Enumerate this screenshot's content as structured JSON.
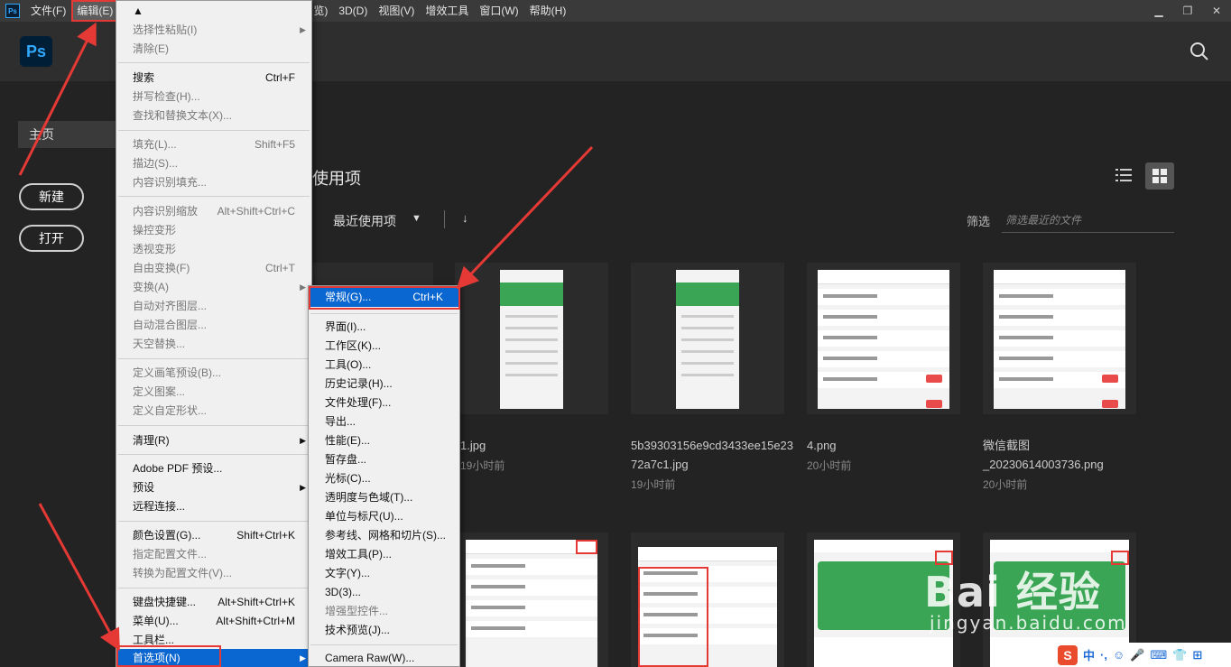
{
  "menubar": {
    "app_icon": "Ps",
    "items": [
      "文件(F)",
      "编辑(E)",
      "视图(V)",
      "增效工具",
      "窗口(W)",
      "帮助(H)"
    ],
    "partial_items": [
      "览)",
      "3D(D)"
    ],
    "window_controls": [
      "minimize-icon",
      "restore-icon",
      "close-icon"
    ]
  },
  "header": {
    "logo": "Ps",
    "search_icon": "search-icon"
  },
  "sidebar": {
    "home": "主页",
    "new_button": "新建",
    "open_button": "打开"
  },
  "main": {
    "section_title": "使用项",
    "sort_label": "最近使用项",
    "sort_dir_icon": "↓",
    "filter_label": "筛选",
    "filter_placeholder": "筛选最近的文件",
    "view_icons": [
      "list-view-icon",
      "grid-view-icon"
    ],
    "files": [
      {
        "name": "1.jpg",
        "time": "19小时前"
      },
      {
        "name": "5b39303156e9cd3433ee15e23 72a7c1.jpg",
        "time": "19小时前"
      },
      {
        "name": "4.png",
        "time": "20小时前"
      },
      {
        "name": "微信截图 _20230614003736.png",
        "time": "20小时前"
      }
    ]
  },
  "edit_menu": {
    "items": [
      {
        "label": "选择性粘贴(I)",
        "shortcut": "",
        "disabled": true
      },
      {
        "label": "清除(E)",
        "shortcut": "",
        "disabled": true
      },
      {
        "label": "搜索",
        "shortcut": "Ctrl+F",
        "disabled": false
      },
      {
        "label": "拼写检查(H)...",
        "shortcut": "",
        "disabled": true
      },
      {
        "label": "查找和替换文本(X)...",
        "shortcut": "",
        "disabled": true
      },
      {
        "label": "填充(L)...",
        "shortcut": "Shift+F5",
        "disabled": true
      },
      {
        "label": "描边(S)...",
        "shortcut": "",
        "disabled": true
      },
      {
        "label": "内容识别填充...",
        "shortcut": "",
        "disabled": true
      },
      {
        "label": "内容识别缩放",
        "shortcut": "Alt+Shift+Ctrl+C",
        "disabled": true
      },
      {
        "label": "操控变形",
        "shortcut": "",
        "disabled": true
      },
      {
        "label": "透视变形",
        "shortcut": "",
        "disabled": true
      },
      {
        "label": "自由变换(F)",
        "shortcut": "Ctrl+T",
        "disabled": true
      },
      {
        "label": "变换(A)",
        "shortcut": "",
        "disabled": true
      },
      {
        "label": "自动对齐图层...",
        "shortcut": "",
        "disabled": true
      },
      {
        "label": "自动混合图层...",
        "shortcut": "",
        "disabled": true
      },
      {
        "label": "天空替换...",
        "shortcut": "",
        "disabled": true
      },
      {
        "label": "定义画笔预设(B)...",
        "shortcut": "",
        "disabled": true
      },
      {
        "label": "定义图案...",
        "shortcut": "",
        "disabled": true
      },
      {
        "label": "定义自定形状...",
        "shortcut": "",
        "disabled": true
      },
      {
        "label": "清理(R)",
        "shortcut": "",
        "disabled": false
      },
      {
        "label": "Adobe PDF 预设...",
        "shortcut": "",
        "disabled": false
      },
      {
        "label": "预设",
        "shortcut": "",
        "disabled": false
      },
      {
        "label": "远程连接...",
        "shortcut": "",
        "disabled": false
      },
      {
        "label": "颜色设置(G)...",
        "shortcut": "Shift+Ctrl+K",
        "disabled": false
      },
      {
        "label": "指定配置文件...",
        "shortcut": "",
        "disabled": true
      },
      {
        "label": "转换为配置文件(V)...",
        "shortcut": "",
        "disabled": true
      },
      {
        "label": "键盘快捷键...",
        "shortcut": "Alt+Shift+Ctrl+K",
        "disabled": false
      },
      {
        "label": "菜单(U)...",
        "shortcut": "Alt+Shift+Ctrl+M",
        "disabled": false
      },
      {
        "label": "工具栏...",
        "shortcut": "",
        "disabled": false
      },
      {
        "label": "首选项(N)",
        "shortcut": "",
        "disabled": false
      }
    ]
  },
  "prefs_menu": {
    "items": [
      {
        "label": "常规(G)...",
        "shortcut": "Ctrl+K",
        "disabled": false
      },
      {
        "label": "界面(I)...",
        "shortcut": "",
        "disabled": false
      },
      {
        "label": "工作区(K)...",
        "shortcut": "",
        "disabled": false
      },
      {
        "label": "工具(O)...",
        "shortcut": "",
        "disabled": false
      },
      {
        "label": "历史记录(H)...",
        "shortcut": "",
        "disabled": false
      },
      {
        "label": "文件处理(F)...",
        "shortcut": "",
        "disabled": false
      },
      {
        "label": "导出...",
        "shortcut": "",
        "disabled": false
      },
      {
        "label": "性能(E)...",
        "shortcut": "",
        "disabled": false
      },
      {
        "label": "暂存盘...",
        "shortcut": "",
        "disabled": false
      },
      {
        "label": "光标(C)...",
        "shortcut": "",
        "disabled": false
      },
      {
        "label": "透明度与色域(T)...",
        "shortcut": "",
        "disabled": false
      },
      {
        "label": "单位与标尺(U)...",
        "shortcut": "",
        "disabled": false
      },
      {
        "label": "参考线、网格和切片(S)...",
        "shortcut": "",
        "disabled": false
      },
      {
        "label": "增效工具(P)...",
        "shortcut": "",
        "disabled": false
      },
      {
        "label": "文字(Y)...",
        "shortcut": "",
        "disabled": false
      },
      {
        "label": "3D(3)...",
        "shortcut": "",
        "disabled": false
      },
      {
        "label": "增强型控件...",
        "shortcut": "",
        "disabled": true
      },
      {
        "label": "技术预览(J)...",
        "shortcut": "",
        "disabled": false
      },
      {
        "label": "Camera Raw(W)...",
        "shortcut": "",
        "disabled": false
      }
    ]
  },
  "watermark": {
    "text": "Bai 经验",
    "url": "jingyan.baidu.com"
  },
  "ime_bar": {
    "items": [
      "S",
      "中",
      "·,",
      "☺",
      "🎤",
      "⌨",
      "👕",
      "⊞"
    ]
  },
  "colors": {
    "accent": "#0a66d0",
    "annotation_red": "#e53935",
    "ps_blue": "#31a8ff"
  }
}
